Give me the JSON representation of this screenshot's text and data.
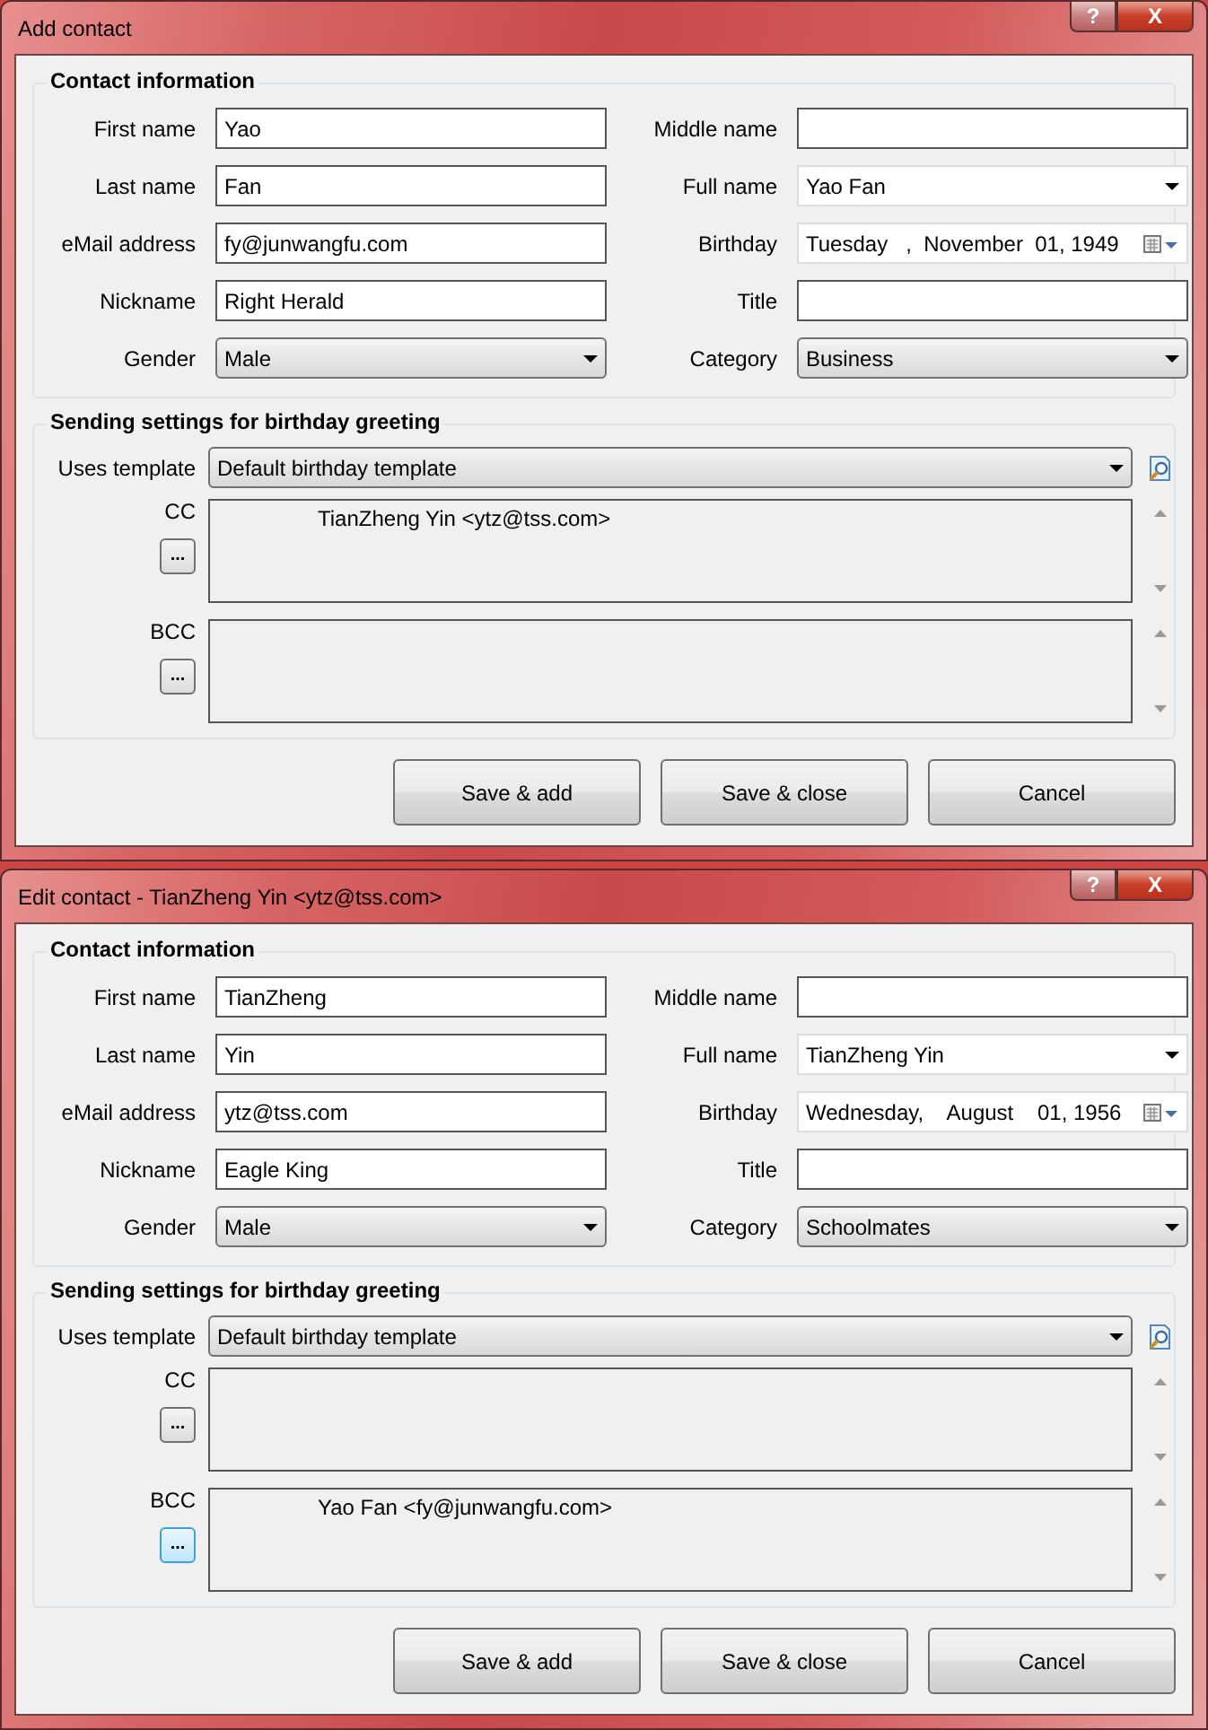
{
  "windows": [
    {
      "title": "Add contact",
      "help_button": "?",
      "close_button": "X",
      "contact_group": {
        "title": "Contact information",
        "fields": [
          {
            "label": "First name",
            "kind": "text",
            "value": "Yao"
          },
          {
            "label": "Middle name",
            "kind": "text"
          },
          {
            "label": "Last name",
            "kind": "text",
            "value": "Fan"
          },
          {
            "label": "Full name",
            "kind": "combo",
            "value": "Yao Fan"
          },
          {
            "label": "eMail address",
            "kind": "text",
            "value": "fy@junwangfu.com"
          },
          {
            "label": "Birthday",
            "kind": "date",
            "value": "Tuesday   ,  November  01, 1949"
          },
          {
            "label": "Nickname",
            "kind": "text",
            "value": "Right Herald"
          },
          {
            "label": "Title",
            "kind": "text"
          },
          {
            "label": "Gender",
            "kind": "select",
            "value": "Male"
          },
          {
            "label": "Category",
            "kind": "select",
            "value": "Business"
          }
        ]
      },
      "greeting_group": {
        "title": "Sending settings for birthday greeting",
        "template": {
          "label": "Uses template",
          "value": "Default birthday template"
        },
        "recipients": [
          {
            "label": "CC",
            "button": "...",
            "focused": false,
            "entries": [
              "TianZheng Yin <ytz@tss.com>"
            ]
          },
          {
            "label": "BCC",
            "button": "...",
            "focused": false
          }
        ]
      },
      "buttons": [
        {
          "label": "Save & add"
        },
        {
          "label": "Save & close"
        },
        {
          "label": "Cancel"
        }
      ]
    },
    {
      "title": "Edit contact - TianZheng Yin <ytz@tss.com>",
      "help_button": "?",
      "close_button": "X",
      "contact_group": {
        "title": "Contact information",
        "fields": [
          {
            "label": "First name",
            "kind": "text",
            "value": "TianZheng"
          },
          {
            "label": "Middle name",
            "kind": "text"
          },
          {
            "label": "Last name",
            "kind": "text",
            "value": "Yin"
          },
          {
            "label": "Full name",
            "kind": "combo",
            "value": "TianZheng Yin"
          },
          {
            "label": "eMail address",
            "kind": "text",
            "value": "ytz@tss.com"
          },
          {
            "label": "Birthday",
            "kind": "date",
            "value": "Wednesday,    August    01, 1956"
          },
          {
            "label": "Nickname",
            "kind": "text",
            "value": "Eagle King"
          },
          {
            "label": "Title",
            "kind": "text"
          },
          {
            "label": "Gender",
            "kind": "select",
            "value": "Male"
          },
          {
            "label": "Category",
            "kind": "select",
            "value": "Schoolmates"
          }
        ]
      },
      "greeting_group": {
        "title": "Sending settings for birthday greeting",
        "template": {
          "label": "Uses template",
          "value": "Default birthday template"
        },
        "recipients": [
          {
            "label": "CC",
            "button": "...",
            "focused": false
          },
          {
            "label": "BCC",
            "button": "...",
            "focused": true,
            "entries": [
              "Yao Fan <fy@junwangfu.com>"
            ]
          }
        ]
      },
      "buttons": [
        {
          "label": "Save & add"
        },
        {
          "label": "Save & close"
        },
        {
          "label": "Cancel"
        }
      ]
    }
  ]
}
